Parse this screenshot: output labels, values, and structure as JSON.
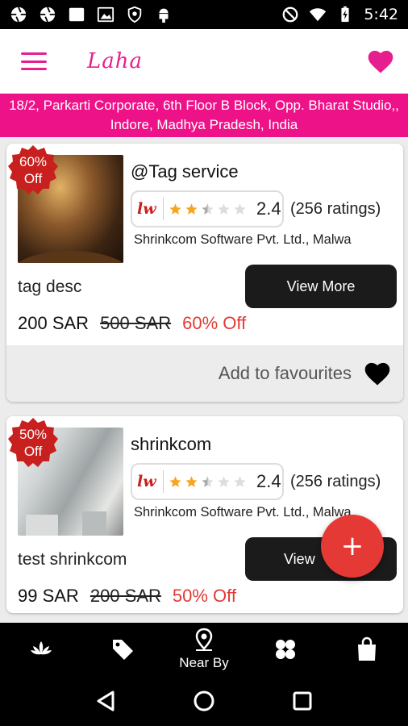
{
  "status_bar": {
    "time": "5:42",
    "icons": [
      "aperture-icon",
      "aperture-icon",
      "square-icon",
      "image-icon",
      "shield-icon",
      "android-icon",
      "no-sim-icon",
      "wifi-icon",
      "battery-charging-icon"
    ]
  },
  "app_bar": {
    "title": "Laha",
    "menu_icon": "hamburger-icon",
    "favorite_icon": "heart-icon",
    "accent_color": "#e51f8e"
  },
  "address": "18/2, Parkarti Corporate, 6th Floor B Block, Opp. Bharat Studio,, Indore, Madhya Pradesh, India",
  "offers": [
    {
      "badge": [
        "60%",
        "Off"
      ],
      "title": "@Tag service",
      "rating_logo": "lw",
      "rating": "2.4",
      "rating_stars": 2.4,
      "ratings_count": "(256 ratings)",
      "company": "Shrinkcom Software Pvt. Ltd., Malwa",
      "description": "tag  desc",
      "view_more": "View More",
      "price": "200 SAR",
      "old_price": "500 SAR",
      "discount": "60% Off",
      "favourite_label": "Add to favourites"
    },
    {
      "badge": [
        "50%",
        "Off"
      ],
      "title": "shrinkcom",
      "rating_logo": "lw",
      "rating": "2.4",
      "rating_stars": 2.4,
      "ratings_count": "(256 ratings)",
      "company": "Shrinkcom Software Pvt. Ltd., Malwa",
      "description": "test shrinkcom",
      "view_more": "View",
      "price": "99 SAR",
      "old_price": "200 SAR",
      "discount": "50% Off"
    }
  ],
  "fab": {
    "label": "+"
  },
  "bottom_nav": [
    {
      "icon": "lotus-icon",
      "label": ""
    },
    {
      "icon": "tag-icon",
      "label": ""
    },
    {
      "icon": "location-pin-icon",
      "label": "Near By"
    },
    {
      "icon": "clover-icon",
      "label": ""
    },
    {
      "icon": "shopping-bag-icon",
      "label": ""
    }
  ],
  "colors": {
    "brand_pink": "#ee1289",
    "discount_red": "#e23a35",
    "fab_red": "#e53935",
    "star_gold": "#f5a623"
  }
}
